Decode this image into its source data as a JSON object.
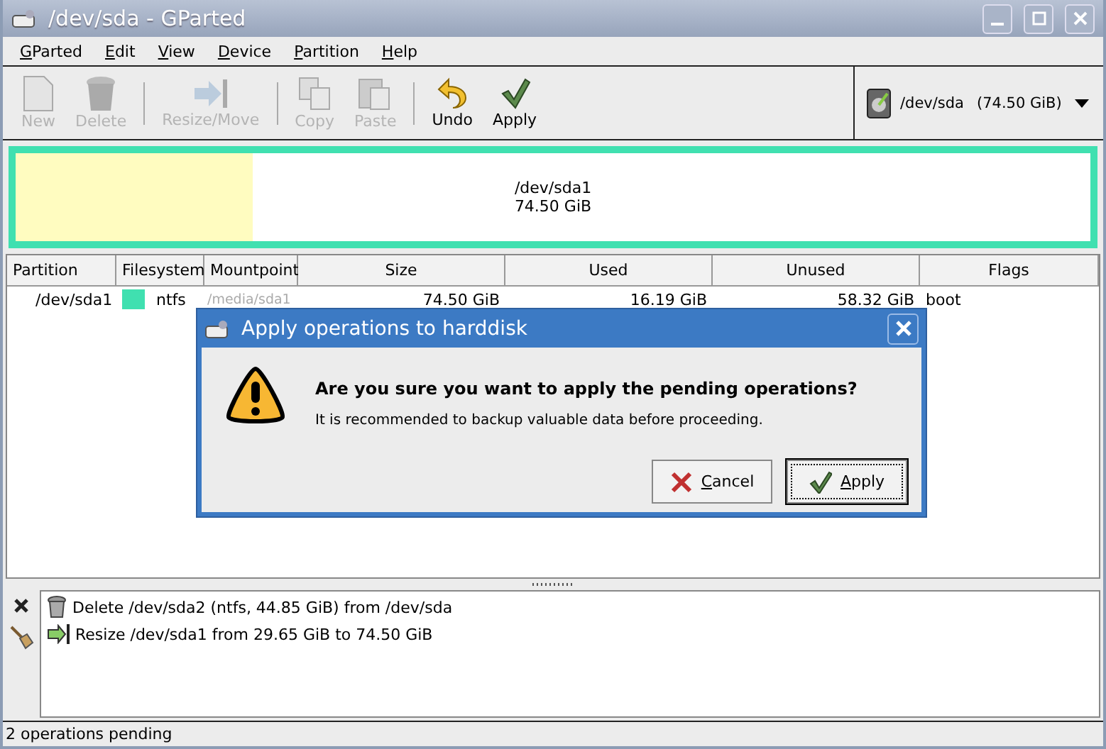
{
  "window": {
    "title": "/dev/sda - GParted"
  },
  "menu": [
    "GParted",
    "Edit",
    "View",
    "Device",
    "Partition",
    "Help"
  ],
  "toolbar": [
    {
      "kind": "new",
      "label": "New",
      "disabled": true
    },
    {
      "kind": "delete",
      "label": "Delete",
      "disabled": true
    },
    {
      "kind": "separator"
    },
    {
      "kind": "resize",
      "label": "Resize/Move",
      "disabled": true
    },
    {
      "kind": "separator"
    },
    {
      "kind": "copy",
      "label": "Copy",
      "disabled": true
    },
    {
      "kind": "paste",
      "label": "Paste",
      "disabled": true
    },
    {
      "kind": "separator"
    },
    {
      "kind": "undo",
      "label": "Undo",
      "disabled": false
    },
    {
      "kind": "apply",
      "label": "Apply",
      "disabled": false
    }
  ],
  "device": {
    "name": "/dev/sda",
    "size": "(74.50 GiB)"
  },
  "disk_map": {
    "name": "/dev/sda1",
    "size": "74.50 GiB",
    "color": "#40e0b0",
    "level": 0.22
  },
  "table": {
    "columns": [
      "Partition",
      "Filesystem",
      "Mountpoint",
      "Size",
      "Used",
      "Unused",
      "Flags"
    ],
    "rows": [
      {
        "partition": "/dev/sda1",
        "filesystem": "ntfs",
        "color": "#40e0b0",
        "mountpoint": "/media/sda1",
        "mounted": false,
        "size": "74.50 GiB",
        "used": "16.19 GiB",
        "unused": "58.32 GiB",
        "flags": "boot"
      }
    ]
  },
  "operations": [
    {
      "kind": "delete",
      "text": "Delete /dev/sda2 (ntfs, 44.85 GiB) from /dev/sda"
    },
    {
      "kind": "resize",
      "text": "Resize /dev/sda1 from 29.65 GiB to 74.50 GiB"
    }
  ],
  "status_bar": "2 operations pending",
  "dialog": {
    "title": "Apply operations to harddisk",
    "heading": "Are you sure you want to apply the pending operations?",
    "message": "It is recommended to backup valuable data before proceeding.",
    "buttons": [
      {
        "kind": "cancel",
        "label": "Cancel",
        "default": false
      },
      {
        "kind": "apply",
        "label": "Apply",
        "default": true
      }
    ]
  }
}
